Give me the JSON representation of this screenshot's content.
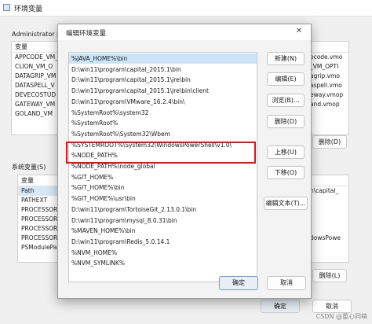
{
  "bg_window": {
    "title": "环境变量",
    "user_section_label": "Administrator 的",
    "system_section_label": "系统变量(S)",
    "user_table_header": "变量",
    "user_vars": [
      "APPCODE_VM_",
      "CLION_VM_O",
      "DATAGRIP_VM",
      "DATASPELL_V",
      "DEVECOSTUD",
      "GATEWAY_VM",
      "GOLAND_VM"
    ],
    "user_values_right": [
      "ocode.vmo",
      "_VM_OPTI",
      "agrip.vmo",
      "aspell.vmo",
      "eway.vmop",
      "and.vmop"
    ],
    "system_table_header": "变量",
    "system_vars": [
      "Path",
      "PATHEXT",
      "PROCESSOR_",
      "PROCESSOR_",
      "PROCESSOR_",
      "PROCESSOR_",
      "PSModulePat"
    ],
    "system_values_right": [
      "n\\capital_",
      "",
      "",
      "",
      "",
      "dowsPowe"
    ],
    "user_delete_btn": "删除(D)",
    "system_delete_btn": "删除(L)",
    "ok_btn": "确定",
    "cancel_btn": "取消"
  },
  "dialog": {
    "title": "编辑环境变量",
    "close_glyph": "✕",
    "paths": [
      "%JAVA_HOME%\\bin",
      "D:\\win11\\program\\capital_2015.1\\bin",
      "D:\\win11\\program\\capital_2015.1\\jre\\bin",
      "D:\\win11\\program\\capital_2015.1\\jre\\bin\\client",
      "D:\\win11\\program\\VMware_16.2.4\\bin\\",
      "%SystemRoot%\\system32",
      "%SystemRoot%",
      "%SystemRoot%\\System32\\Wbem",
      "%SYSTEMROOT%\\System32\\WindowsPowerShell\\v1.0\\",
      "%NODE_PATH%",
      "%NODE_PATH%\\node_global",
      "%GIT_HOME%",
      "%GIT_HOME%\\bin",
      "%GIT_HOME%\\usr\\bin",
      "D:\\win11\\program\\TortoiseGit_2.13.0.1\\bin",
      "D:\\win11\\program\\mysql_8.0.31\\bin",
      "%MAVEN_HOME%\\bin",
      "D:\\win11\\program\\Redis_5.0.14.1",
      "%NVM_HOME%",
      "%NVM_SYMLINK%"
    ],
    "selected_index": 0,
    "buttons": {
      "new": "新建(N)",
      "edit": "编辑(E)",
      "browse": "浏览(B)...",
      "delete": "删除(D)",
      "move_up": "上移(U)",
      "move_down": "下移(O)",
      "edit_text": "编辑文本(T)...",
      "ok": "确定",
      "cancel": "取消"
    }
  },
  "watermark": "CSDN @重心同萌"
}
